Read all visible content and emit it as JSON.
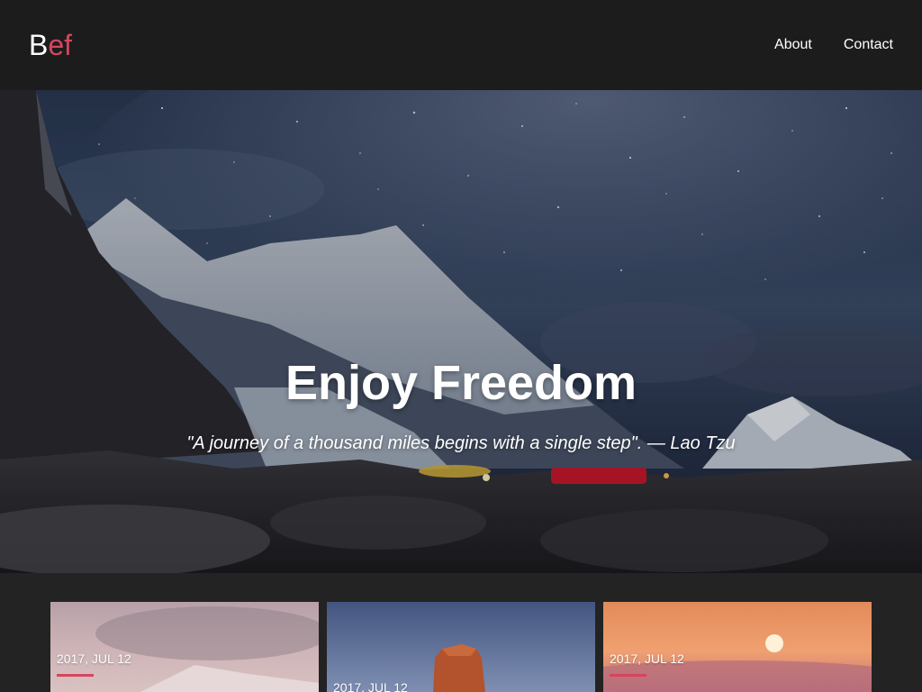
{
  "header": {
    "logo_first": "B",
    "logo_rest": "ef",
    "nav": [
      {
        "label": "About"
      },
      {
        "label": "Contact"
      }
    ]
  },
  "hero": {
    "title": "Enjoy Freedom",
    "quote": "\"A journey of a thousand miles begins with a single step\". — Lao Tzu"
  },
  "cards": [
    {
      "date": "2017, JUL 12"
    },
    {
      "date": "2017, JUL 12"
    },
    {
      "date": "2017, JUL 12"
    }
  ],
  "colors": {
    "accent": "#d6455f",
    "header_bg": "#1c1c1c",
    "page_bg": "#232323"
  }
}
